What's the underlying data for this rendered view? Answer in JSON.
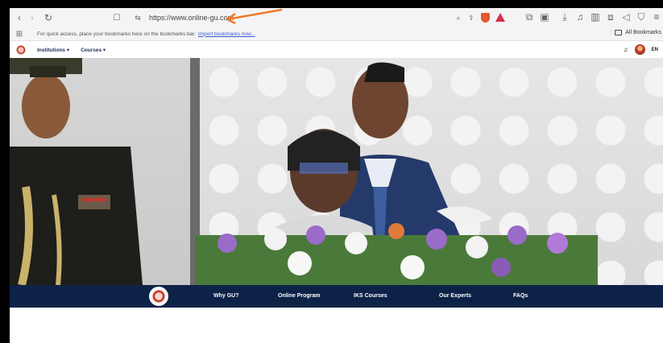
{
  "browser": {
    "url": "https://www.online-gu.com",
    "bookmarks_hint": "For quick access, place your bookmarks here on the bookmarks bar.",
    "import_link": "Import bookmarks now...",
    "all_bookmarks": "All Bookmarks"
  },
  "site_nav": {
    "items": [
      {
        "label": "Institutions ▾"
      },
      {
        "label": "Courses ▾"
      }
    ],
    "language": "EN"
  },
  "footer_nav": {
    "items": [
      {
        "label": "Why GU?"
      },
      {
        "label": "Online Program"
      },
      {
        "label": "IKS Courses"
      },
      {
        "label": "Our Experts"
      },
      {
        "label": "FAQs"
      }
    ]
  },
  "colors": {
    "nav_bg": "#0c2247",
    "accent_arrow": "#f07a2a",
    "link": "#3a5bd0"
  },
  "icons": [
    "back-icon",
    "forward-icon",
    "reload-icon",
    "bookmark-icon",
    "site-settings-icon",
    "zoom-icon",
    "share-icon",
    "brave-shield-icon",
    "brave-rewards-icon",
    "extensions-icon",
    "download-icon",
    "playlist-icon",
    "sidebar-icon",
    "wallet-icon",
    "vpn-icon",
    "menu-icon",
    "apps-icon",
    "folder-icon",
    "notification-bell-icon"
  ]
}
